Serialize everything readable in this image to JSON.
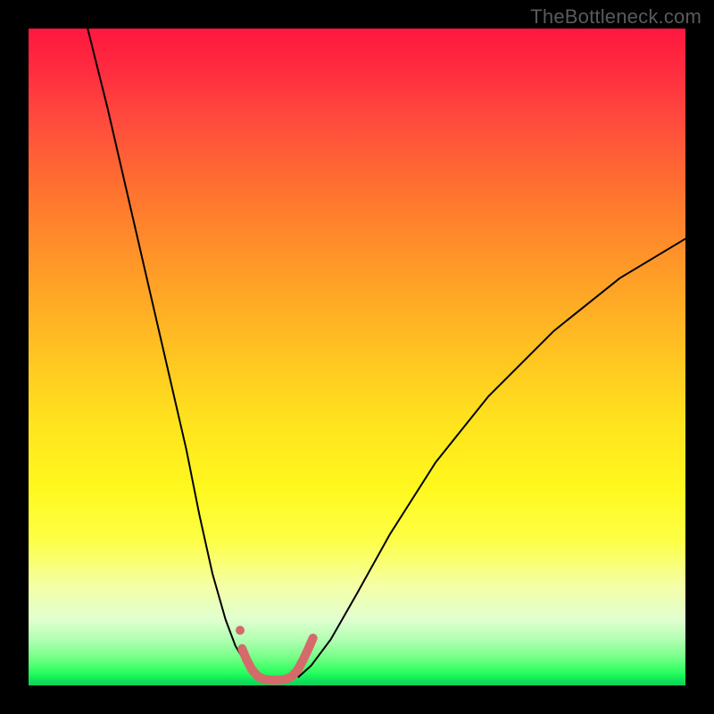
{
  "watermark": "TheBottleneck.com",
  "chart_data": {
    "type": "line",
    "title": "",
    "xlabel": "",
    "ylabel": "",
    "xlim": [
      0,
      100
    ],
    "ylim": [
      0,
      100
    ],
    "grid": false,
    "gradient_stops": [
      {
        "pct": 0,
        "color": "#ff173f"
      },
      {
        "pct": 6,
        "color": "#ff2b3f"
      },
      {
        "pct": 14,
        "color": "#ff4b3e"
      },
      {
        "pct": 24,
        "color": "#ff7030"
      },
      {
        "pct": 36,
        "color": "#ff9828"
      },
      {
        "pct": 48,
        "color": "#ffbf22"
      },
      {
        "pct": 60,
        "color": "#ffe31e"
      },
      {
        "pct": 70,
        "color": "#fff81e"
      },
      {
        "pct": 78,
        "color": "#fdff47"
      },
      {
        "pct": 85,
        "color": "#f4ffa8"
      },
      {
        "pct": 90,
        "color": "#e0ffd0"
      },
      {
        "pct": 93,
        "color": "#b2ffb2"
      },
      {
        "pct": 95.5,
        "color": "#7cff8c"
      },
      {
        "pct": 97,
        "color": "#4dff70"
      },
      {
        "pct": 98,
        "color": "#2aff60"
      },
      {
        "pct": 99,
        "color": "#13e85a"
      },
      {
        "pct": 100,
        "color": "#0fd058"
      }
    ],
    "series": [
      {
        "name": "left-curve",
        "color": "#000000",
        "width": 2,
        "x": [
          9,
          12,
          15,
          18,
          21,
          24,
          26,
          28,
          30,
          31.5,
          33,
          34,
          35
        ],
        "y": [
          100,
          88,
          75,
          62,
          49,
          36,
          26,
          17,
          10,
          6,
          3.5,
          2,
          1.2
        ]
      },
      {
        "name": "right-curve",
        "color": "#000000",
        "width": 2,
        "x": [
          41,
          43,
          46,
          50,
          55,
          62,
          70,
          80,
          90,
          100
        ],
        "y": [
          1.2,
          3,
          7,
          14,
          23,
          34,
          44,
          54,
          62,
          68
        ]
      },
      {
        "name": "valley-highlight",
        "color": "#d46a6a",
        "width": 10,
        "linecap": "round",
        "x": [
          32.5,
          33.2,
          34,
          35,
          36,
          37,
          38,
          39,
          40,
          41,
          41.8,
          42.6,
          43.3
        ],
        "y": [
          5.6,
          3.9,
          2.4,
          1.3,
          0.9,
          0.8,
          0.8,
          0.9,
          1.3,
          2.4,
          3.9,
          5.6,
          7.2
        ]
      }
    ],
    "markers": [
      {
        "name": "valley-dot",
        "x": 32.2,
        "y": 8.4,
        "r": 5,
        "color": "#d46a6a"
      }
    ]
  }
}
